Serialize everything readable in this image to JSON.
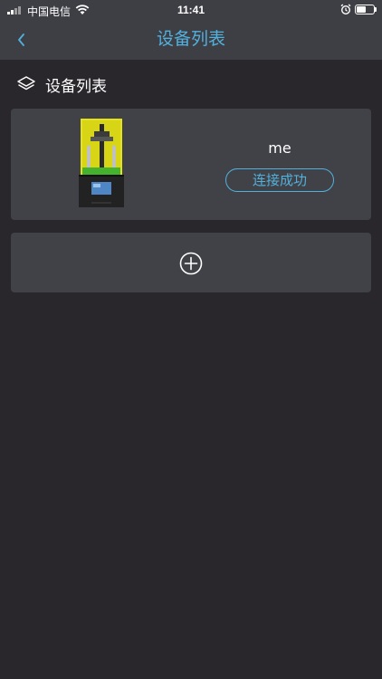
{
  "status_bar": {
    "carrier": "中国电信",
    "time": "11:41",
    "battery_level": 0.55
  },
  "nav": {
    "title": "设备列表"
  },
  "section": {
    "title": "设备列表"
  },
  "devices": [
    {
      "name": "me",
      "status": "连接成功"
    }
  ],
  "colors": {
    "accent": "#52b0dd",
    "background": "#2a272c",
    "card": "#414248",
    "bar": "#3e3f45"
  },
  "icons": {
    "back": "chevron-left-icon",
    "section": "layers-icon",
    "add": "plus-circle-icon"
  }
}
